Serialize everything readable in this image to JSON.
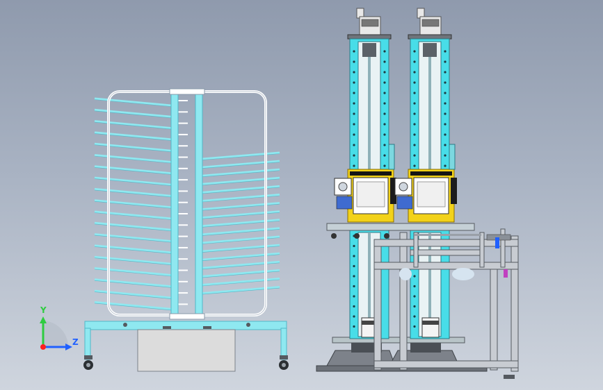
{
  "viewport": {
    "background_top": "#8f9aad",
    "background_bottom": "#cfd5de"
  },
  "palette": {
    "frame_cyan": "#8fe8f0",
    "frame_cyan_dark": "#4fb8c8",
    "frame_white": "#ffffff",
    "panel_grey": "#dcdcdc",
    "column_cyan": "#48dde8",
    "aluminium": "#c8ccd2",
    "steel_dark": "#555a60",
    "yellow_plate": "#f2d21a",
    "motor_body": "#e8e8e8"
  },
  "triad": {
    "y_label": "Y",
    "z_label": "Z",
    "y_color": "#2ecc40",
    "z_color": "#2060ff",
    "origin_color": "#ff2020"
  },
  "rack": {
    "slot_count": 19
  },
  "machine": {
    "column_count": 2
  }
}
